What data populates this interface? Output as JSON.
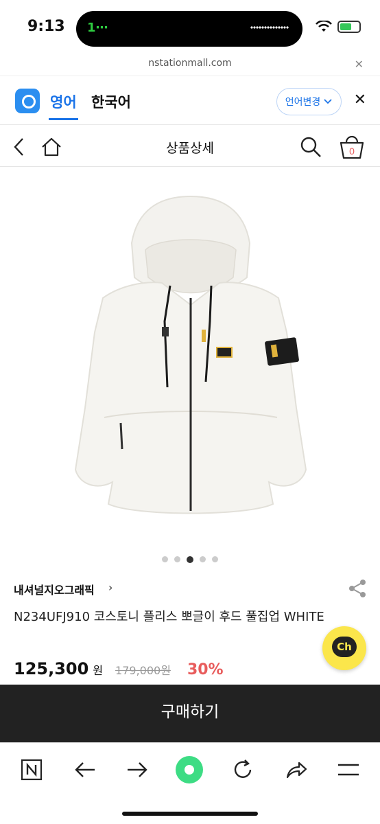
{
  "status": {
    "time": "9:13",
    "call_label": "1⋯",
    "battery_level": 0.6
  },
  "url_bar": {
    "url": "nstationmall.com",
    "close_label": "✕"
  },
  "translator": {
    "source_lang": "영어",
    "target_lang": "한국어",
    "change_label": "언어변경",
    "close_label": "✕"
  },
  "header": {
    "title": "상품상세",
    "cart_count": "0"
  },
  "carousel": {
    "total": 5,
    "active_index": 2
  },
  "product": {
    "brand": "내셔널지오그래픽",
    "brand_chevron": "›",
    "title": "N234UFJ910 코스토니 플리스 뽀글이 후드 풀집업 WHITE",
    "price": "125,300",
    "price_unit": "원",
    "original_price": "179,000원",
    "discount": "30%"
  },
  "chat": {
    "label": "Ch"
  },
  "buy_button": {
    "label": "구매하기"
  },
  "colors": {
    "accent": "#1a73e8",
    "discount": "#e85c5c",
    "buy_bar": "#222222",
    "chat": "#fbe64b"
  },
  "bottom_nav": [
    {
      "icon": "naver-home-icon"
    },
    {
      "icon": "back-arrow-icon"
    },
    {
      "icon": "forward-arrow-icon"
    },
    {
      "icon": "green-dot-icon"
    },
    {
      "icon": "reload-icon"
    },
    {
      "icon": "share-arrow-icon"
    },
    {
      "icon": "menu-icon"
    }
  ]
}
